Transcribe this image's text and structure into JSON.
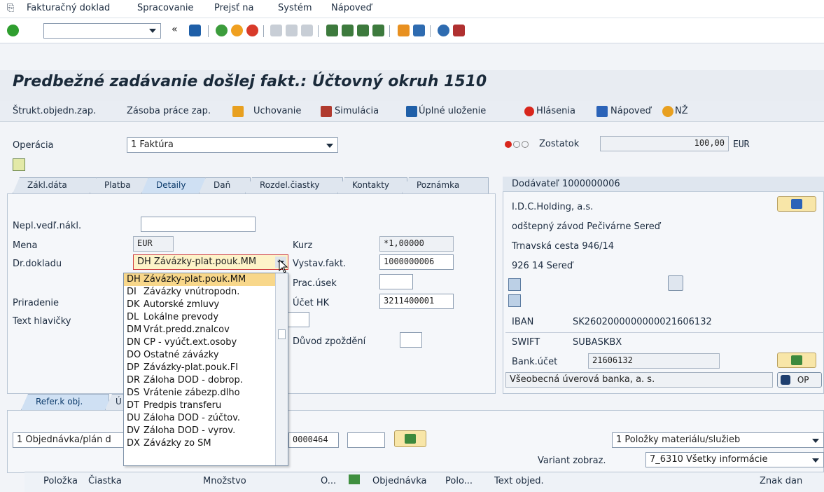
{
  "menu": {
    "items": [
      {
        "label": "Fakturačný doklad"
      },
      {
        "label": "Spracovanie"
      },
      {
        "label": "Prejsť na"
      },
      {
        "label": "Systém"
      },
      {
        "label": "Nápoveď"
      }
    ]
  },
  "toolbar": {
    "command_field_value": "",
    "back_symbol": "«"
  },
  "page": {
    "title": "Predbežné zadávanie došlej fakt.: Účtovný okruh 1510"
  },
  "app_toolbar": {
    "struct_label": "Štrukt.objedn.zap.",
    "worklist_label": "Zásoba práce zap.",
    "hold_label": "Uchovanie",
    "simulate_label": "Simulácia",
    "save_label": "Úplné uloženie",
    "messages_label": "Hlásenia",
    "help_label": "Nápoveď",
    "nz_label": "NŽ"
  },
  "header": {
    "operation_label": "Operácia",
    "operation_value": "1 Faktúra",
    "balance_label": "Zostatok",
    "balance_value": "100,00",
    "balance_currency": "EUR"
  },
  "tabs": [
    {
      "label": "Zákl.dáta"
    },
    {
      "label": "Platba"
    },
    {
      "label": "Detaily"
    },
    {
      "label": "Daň"
    },
    {
      "label": "Rozdel.čiastky"
    },
    {
      "label": "Kontakty"
    },
    {
      "label": "Poznámka"
    }
  ],
  "details": {
    "unplanned_costs_label": "Nepl.vedľ.nákl.",
    "unplanned_costs_value": "",
    "currency_label": "Mena",
    "currency_value": "EUR",
    "doc_type_label": "Dr.dokladu",
    "doc_type_value": "DH Závázky-plat.pouk.MM",
    "assignment_label": "Priradenie",
    "header_text_label": "Text hlavičky",
    "rate_label": "Kurz",
    "rate_value": "*1,00000",
    "issuer_label": "Vystav.fakt.",
    "issuer_value": "1000000006",
    "business_area_label": "Prac.úsek",
    "business_area_value": "",
    "gl_account_label": "Účet HK",
    "gl_account_value": "3211400001",
    "delay_reason_label": "Důvod zpoždění",
    "delay_reason_value": ""
  },
  "doc_type_dropdown": {
    "options": [
      {
        "code": "DH",
        "text": "Závázky-plat.pouk.MM"
      },
      {
        "code": "DI",
        "text": "Závázky vnútropodn."
      },
      {
        "code": "DK",
        "text": "Autorské zmluvy"
      },
      {
        "code": "DL",
        "text": "Lokálne prevody"
      },
      {
        "code": "DM",
        "text": "Vrát.predd.znalcov"
      },
      {
        "code": "DN",
        "text": "CP - vyúčt.ext.osoby"
      },
      {
        "code": "DO",
        "text": "Ostatné závázky"
      },
      {
        "code": "DP",
        "text": "Závázky-plat.pouk.FI"
      },
      {
        "code": "DR",
        "text": "Záloha DOD - dobrop."
      },
      {
        "code": "DS",
        "text": "Vrátenie zábezp.dlho"
      },
      {
        "code": "DT",
        "text": "Predpis transferu"
      },
      {
        "code": "DU",
        "text": "Záloha DOD - zúčtov."
      },
      {
        "code": "DV",
        "text": "Záloha DOD - vyrov."
      },
      {
        "code": "DX",
        "text": "Závázky zo SM"
      }
    ]
  },
  "vendor": {
    "title": "Dodávateľ 1000000006",
    "name": "I.D.C.Holding, a.s.",
    "branch": "odštepný závod Pečivárne Sereď",
    "street": "Trnavská cesta 946/14",
    "city": "926 14 Sereď",
    "iban_label": "IBAN",
    "iban_value": "SK2602000000000021606132",
    "swift_label": "SWIFT",
    "swift_value": "SUBASKBX",
    "bank_account_label": "Bank.účet",
    "bank_account_value": "21606132",
    "bank_name": "Všeobecná úverová banka, a. s.",
    "op_label": "OP"
  },
  "ref_section": {
    "tab1_label": "Refer.k obj.",
    "tab2_label_partial": "Ú",
    "ref_type_value": "1 Objednávka/plán d",
    "po_number_value": "0000464",
    "items_type_value": "1 Položky materiálu/služieb",
    "variant_label": "Variant zobraz.",
    "variant_value": "7_6310 Všetky informácie"
  },
  "items_table": {
    "columns": [
      {
        "label": "Položka"
      },
      {
        "label": "Čiastka"
      },
      {
        "label": "Množstvo"
      },
      {
        "label": "O..."
      },
      {
        "label": "Objednávka"
      },
      {
        "label": "Polo..."
      },
      {
        "label": "Text objed."
      },
      {
        "label": "Znak dan"
      }
    ]
  },
  "colors": {
    "accent": "#f8d78a",
    "title_bg": "#e8ecf2"
  }
}
